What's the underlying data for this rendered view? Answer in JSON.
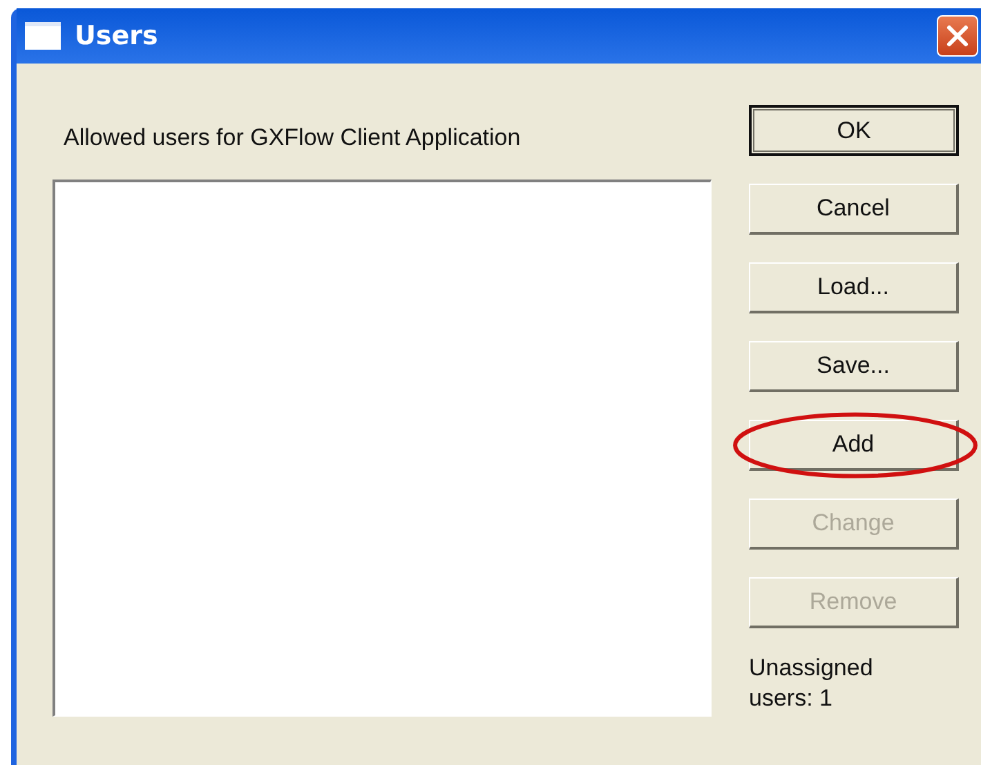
{
  "window": {
    "title": "Users"
  },
  "list": {
    "label": "Allowed users for GXFlow Client Application"
  },
  "buttons": [
    {
      "label": "OK",
      "default": true,
      "disabled": false,
      "circled": false
    },
    {
      "label": "Cancel",
      "default": false,
      "disabled": false,
      "circled": false
    },
    {
      "label": "Load...",
      "default": false,
      "disabled": false,
      "circled": false
    },
    {
      "label": "Save...",
      "default": false,
      "disabled": false,
      "circled": false
    },
    {
      "label": "Add",
      "default": false,
      "disabled": false,
      "circled": true
    },
    {
      "label": "Change",
      "default": false,
      "disabled": true,
      "circled": false
    },
    {
      "label": "Remove",
      "default": false,
      "disabled": true,
      "circled": false
    }
  ],
  "status": "Unassigned users: 1"
}
